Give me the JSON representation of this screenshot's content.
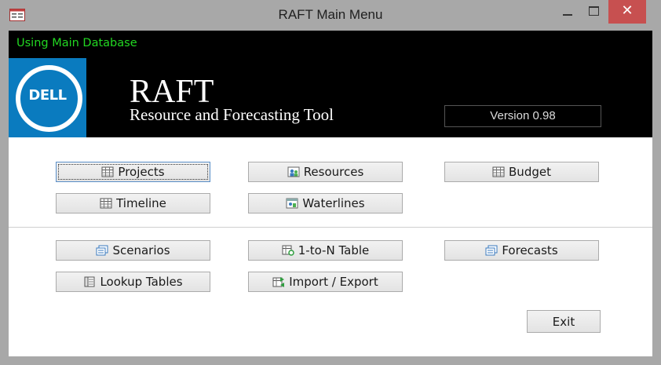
{
  "window": {
    "title": "RAFT Main Menu",
    "close_glyph": "✕"
  },
  "status": {
    "database": "Using Main Database"
  },
  "header": {
    "logo_text": "DELL",
    "title": "RAFT",
    "subtitle": "Resource and Forecasting Tool",
    "version": "Version 0.98",
    "logo_color": "#0a7bbf"
  },
  "buttons": {
    "projects": "Projects",
    "resources": "Resources",
    "budget": "Budget",
    "timeline": "Timeline",
    "waterlines": "Waterlines",
    "scenarios": "Scenarios",
    "one_to_n": "1-to-N Table",
    "forecasts": "Forecasts",
    "lookup_tables": "Lookup Tables",
    "import_export": "Import / Export",
    "exit": "Exit"
  },
  "icons": {
    "projects": "table-icon",
    "resources": "people-icon",
    "budget": "table-icon",
    "timeline": "table-icon",
    "waterlines": "chart-icon",
    "scenarios": "forms-icon",
    "one_to_n": "refresh-table-icon",
    "forecasts": "forms-icon",
    "lookup_tables": "form-icon",
    "import_export": "import-export-icon"
  }
}
